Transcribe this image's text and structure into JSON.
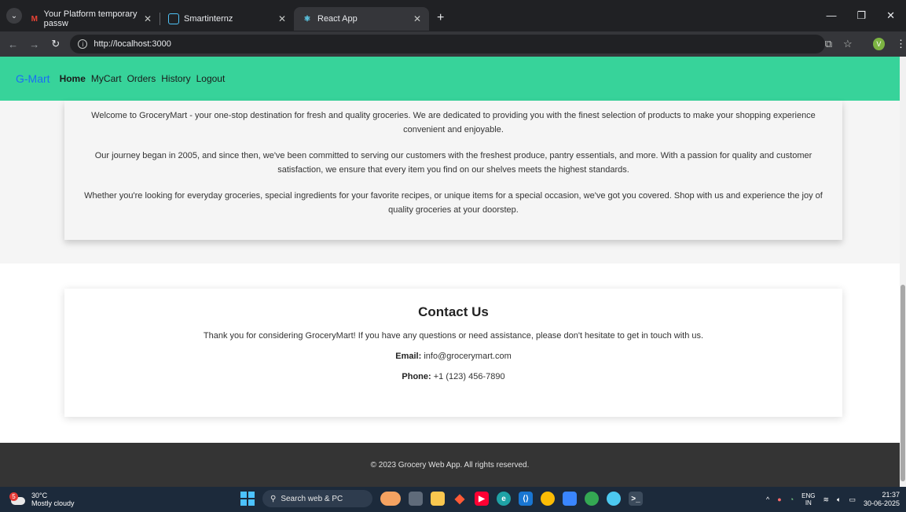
{
  "browser": {
    "tabs": [
      {
        "label": "Your Platform temporary passw",
        "favicon": "gmail-icon"
      },
      {
        "label": "Smartinternz",
        "favicon": "shield-icon"
      },
      {
        "label": "React App",
        "favicon": "react-icon",
        "active": true
      }
    ],
    "url": "http://localhost:3000",
    "profile_initial": "V"
  },
  "app": {
    "brand": "G-Mart",
    "nav": [
      "Home",
      "MyCart",
      "Orders",
      "History",
      "Logout"
    ],
    "active_nav": "Home",
    "accent_color": "#37d39a",
    "brand_color": "#1a6df5"
  },
  "about": {
    "paragraphs": [
      "Welcome to GroceryMart - your one-stop destination for fresh and quality groceries. We are dedicated to providing you with the finest selection of products to make your shopping experience convenient and enjoyable.",
      "Our journey began in 2005, and since then, we've been committed to serving our customers with the freshest produce, pantry essentials, and more. With a passion for quality and customer satisfaction, we ensure that every item you find on our shelves meets the highest standards.",
      "Whether you're looking for everyday groceries, special ingredients for your favorite recipes, or unique items for a special occasion, we've got you covered. Shop with us and experience the joy of quality groceries at your doorstep."
    ]
  },
  "contact": {
    "title": "Contact Us",
    "intro": "Thank you for considering GroceryMart! If you have any questions or need assistance, please don't hesitate to get in touch with us.",
    "email_label": "Email:",
    "email": "info@grocerymart.com",
    "phone_label": "Phone:",
    "phone": "+1 (123) 456-7890"
  },
  "footer": {
    "text": "© 2023 Grocery Web App. All rights reserved."
  },
  "taskbar": {
    "weather_temp": "30°C",
    "weather_desc": "Mostly cloudy",
    "weather_badge": "5",
    "search_placeholder": "Search web & PC",
    "lang_top": "ENG",
    "lang_bottom": "IN",
    "time": "21:37",
    "date": "30-06-2025"
  }
}
